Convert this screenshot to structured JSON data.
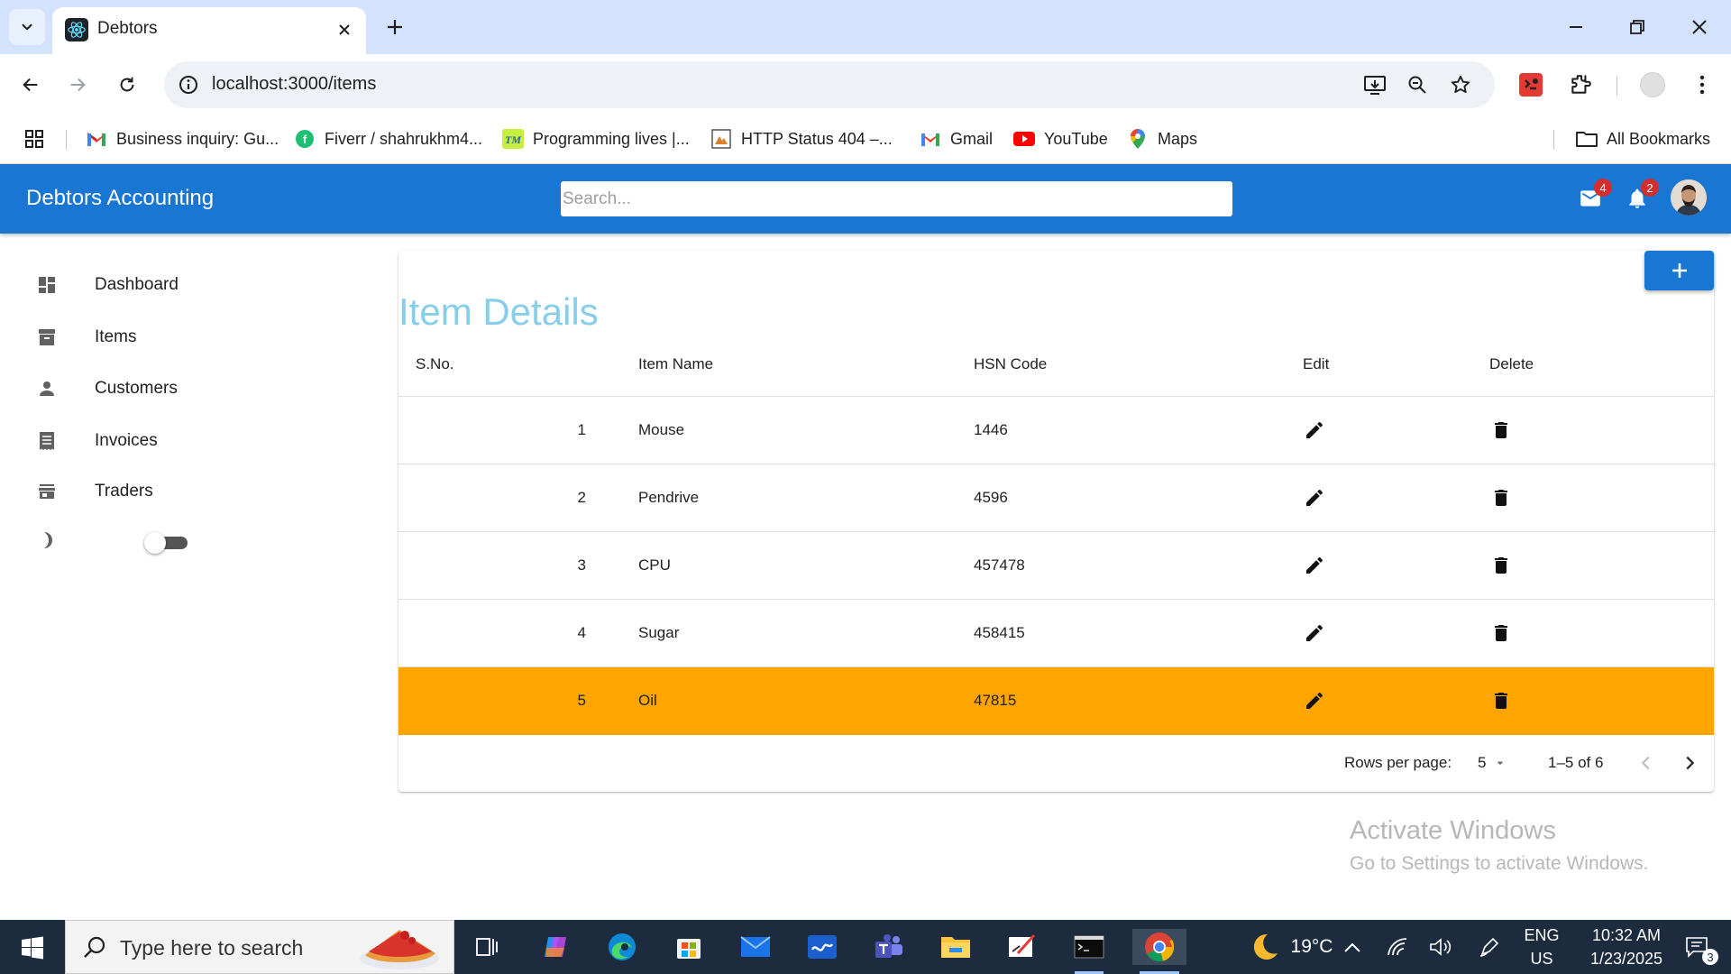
{
  "browser": {
    "tab_title": "Debtors",
    "url": "localhost:3000/items",
    "bookmarks": [
      {
        "label": "Business inquiry: Gu...",
        "icon": "gmail-icon"
      },
      {
        "label": "Fiverr / shahrukhm4...",
        "icon": "fiverr-icon"
      },
      {
        "label": "Programming lives |...",
        "icon": "tm-icon"
      },
      {
        "label": "HTTP Status 404 –...",
        "icon": "tomcat-icon"
      },
      {
        "label": "Gmail",
        "icon": "gmail-icon"
      },
      {
        "label": "YouTube",
        "icon": "youtube-icon"
      },
      {
        "label": "Maps",
        "icon": "maps-icon"
      }
    ],
    "all_bookmarks_label": "All Bookmarks"
  },
  "app": {
    "title": "Debtors Accounting",
    "search_placeholder": "Search...",
    "mail_count": "4",
    "notification_count": "2",
    "brand_color": "#1976d2"
  },
  "sidebar": {
    "items": [
      {
        "label": "Dashboard",
        "icon": "dashboard-icon"
      },
      {
        "label": "Items",
        "icon": "archive-icon"
      },
      {
        "label": "Customers",
        "icon": "person-icon"
      },
      {
        "label": "Invoices",
        "icon": "receipt-icon"
      },
      {
        "label": "Traders",
        "icon": "store-icon"
      }
    ],
    "dark_mode_on": false
  },
  "page": {
    "title": "Item Details",
    "title_color": "#87ceeb",
    "highlight_color": "#ffa500",
    "columns": [
      "S.No.",
      "Item Name",
      "HSN Code",
      "Edit",
      "Delete"
    ],
    "rows": [
      {
        "sno": "1",
        "name": "Mouse",
        "hsn": "1446",
        "highlighted": false
      },
      {
        "sno": "2",
        "name": "Pendrive",
        "hsn": "4596",
        "highlighted": false
      },
      {
        "sno": "3",
        "name": "CPU",
        "hsn": "457478",
        "highlighted": false
      },
      {
        "sno": "4",
        "name": "Sugar",
        "hsn": "458415",
        "highlighted": false
      },
      {
        "sno": "5",
        "name": "Oil",
        "hsn": "47815",
        "highlighted": true
      }
    ],
    "pagination": {
      "rows_per_page_label": "Rows per page:",
      "rows_per_page": "5",
      "range": "1–5 of 6"
    }
  },
  "watermark": {
    "title": "Activate Windows",
    "subtitle": "Go to Settings to activate Windows."
  },
  "taskbar": {
    "search_placeholder": "Type here to search",
    "temperature": "19°C",
    "lang_top": "ENG",
    "lang_bottom": "US",
    "time": "10:32 AM",
    "date": "1/23/2025",
    "notification_count": "3"
  }
}
